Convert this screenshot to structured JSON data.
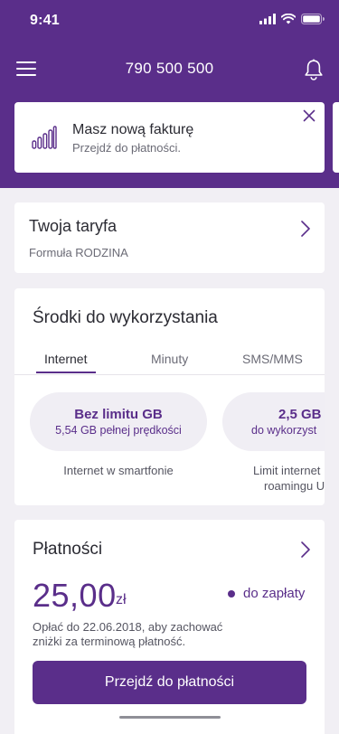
{
  "status_bar": {
    "time": "9:41"
  },
  "header": {
    "phone_number": "790 500 500"
  },
  "notification": {
    "title": "Masz nową fakturę",
    "subtitle": "Przejdź do płatności."
  },
  "tariff": {
    "title": "Twoja taryfa",
    "plan": "Formuła RODZINA"
  },
  "resources": {
    "title": "Środki do wykorzystania",
    "tabs": [
      {
        "label": "Internet",
        "active": true
      },
      {
        "label": "Minuty",
        "active": false
      },
      {
        "label": "SMS/MMS",
        "active": false
      }
    ],
    "items": [
      {
        "main": "Bez limitu GB",
        "sub": "5,54 GB pełnej prędkości",
        "caption_line1": "Internet w smartfonie",
        "caption_line2": ""
      },
      {
        "main": "2,5 GB",
        "sub": "do wykorzyst",
        "caption_line1": "Limit internet",
        "caption_line2": "roamingu U"
      }
    ]
  },
  "payments": {
    "title": "Płatności",
    "amount": "25,00",
    "currency": "zł",
    "status": "do zapłaty",
    "note": "Opłać do 22.06.2018, aby zachować zniżki za terminową płatność.",
    "button_label": "Przejdź do płatności"
  },
  "colors": {
    "brand": "#5a2e8a",
    "background": "#f1eff4",
    "pill": "#f0eef4"
  }
}
